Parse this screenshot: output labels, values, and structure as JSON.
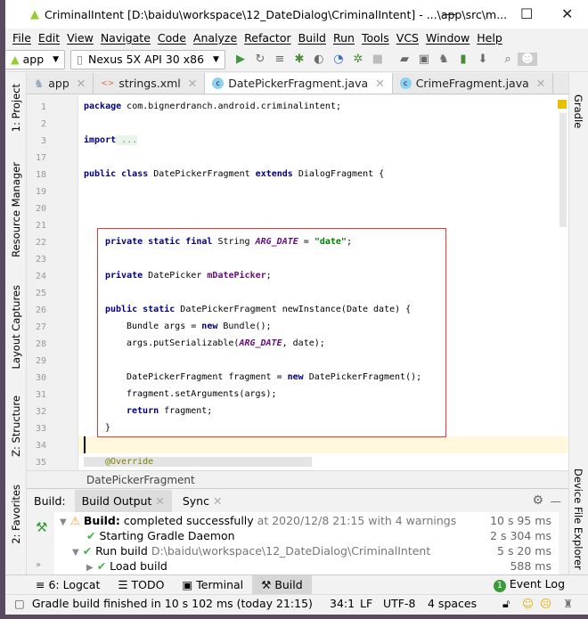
{
  "window": {
    "title": "CriminalIntent [D:\\baidu\\workspace\\12_DateDialog\\CriminalIntent] - ...\\app\\src\\m..."
  },
  "menu": [
    "File",
    "Edit",
    "View",
    "Navigate",
    "Code",
    "Analyze",
    "Refactor",
    "Build",
    "Run",
    "Tools",
    "VCS",
    "Window",
    "Help"
  ],
  "toolbar": {
    "module": "app",
    "device": "Nexus 5X API 30 x86"
  },
  "tabs": [
    {
      "label": "app"
    },
    {
      "label": "strings.xml"
    },
    {
      "label": "DatePickerFragment.java",
      "active": true
    },
    {
      "label": "CrimeFragment.java"
    }
  ],
  "left_tools": [
    "1: Project",
    "Resource Manager",
    "Layout Captures",
    "Z: Structure",
    "2: Favorites"
  ],
  "right_tools": [
    "Gradle",
    "Device File Explorer"
  ],
  "editor": {
    "line_numbers": [
      "1",
      "2",
      "3",
      "17",
      "18",
      "19",
      "20",
      "21",
      "22",
      "23",
      "24",
      "25",
      "26",
      "27",
      "28",
      "29",
      "30",
      "31",
      "32",
      "33",
      "34",
      "35"
    ],
    "line1": [
      "package",
      " com.bignerdranch.android.criminalintent;"
    ],
    "line3": [
      "import",
      " ..."
    ],
    "line18": [
      "public class",
      " DatePickerFragment ",
      "extends",
      " DialogFragment {"
    ],
    "line22": [
      "private static final",
      " String ",
      "ARG_DATE",
      " = ",
      "\"date\"",
      ";"
    ],
    "line24": [
      "private",
      " DatePicker ",
      "mDatePicker",
      ";"
    ],
    "line26": [
      "public static",
      " DatePickerFragment newInstance(Date date) {"
    ],
    "line27": [
      "Bundle args = ",
      "new",
      " Bundle();"
    ],
    "line28": [
      "args.putSerializable(",
      "ARG_DATE",
      ", date);"
    ],
    "line30": [
      "DatePickerFragment fragment = ",
      "new",
      " DatePickerFragment();"
    ],
    "line31": "fragment.setArguments(args);",
    "line32": [
      "return",
      " fragment;"
    ],
    "line33": "}",
    "line35": "@Override",
    "breadcrumb": "DatePickerFragment"
  },
  "build": {
    "label": "Build:",
    "tab_output": "Build Output",
    "tab_sync": "Sync",
    "rows": [
      {
        "bold": "Build:",
        "text": " completed successfully",
        "extra": " at 2020/12/8 21:15  with 4 warnings",
        "time": "10 s 95 ms"
      },
      {
        "text": "Starting Gradle Daemon",
        "time": "2 s 304 ms"
      },
      {
        "text": "Run build",
        "extra": " D:\\baidu\\workspace\\12_DateDialog\\CriminalIntent",
        "time": "5 s 20 ms"
      },
      {
        "text": "Load build",
        "time": "588 ms"
      }
    ]
  },
  "bottom_tabs": [
    "6: Logcat",
    "TODO",
    "Terminal",
    "Build"
  ],
  "event_log": {
    "count": "1",
    "label": "Event Log"
  },
  "status": {
    "message": "Gradle build finished in 10 s 102 ms (today 21:15)",
    "position": "34:1",
    "line_sep": "LF",
    "encoding": "UTF-8",
    "indent": "4 spaces"
  }
}
